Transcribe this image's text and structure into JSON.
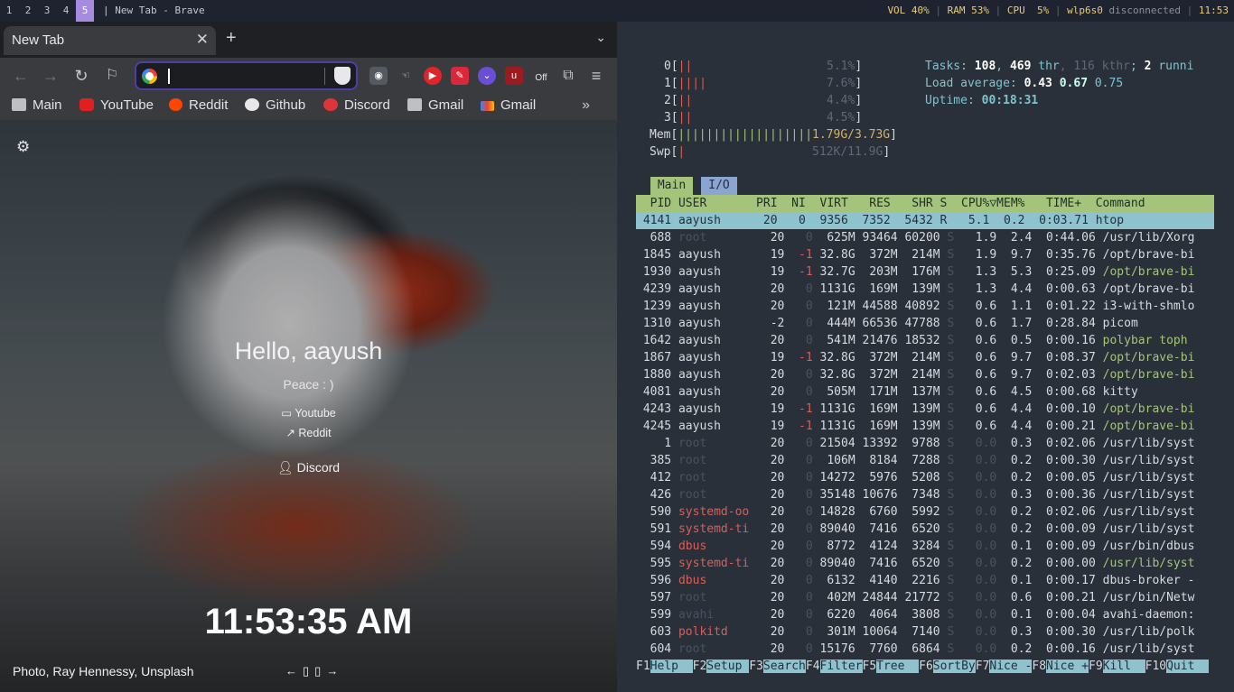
{
  "bar": {
    "workspaces": [
      "1",
      "2",
      "3",
      "4",
      "5"
    ],
    "title": "| New Tab - Brave",
    "vol": "VOL 40%",
    "ram": "RAM 53%",
    "cpu": "CPU  5%",
    "net": "wlp6s0",
    "net_state": "disconnected",
    "clock": "11:53"
  },
  "browser": {
    "tab_title": "New Tab",
    "bookmarks": [
      "Main",
      "YouTube",
      "Reddit",
      "Github",
      "Discord",
      "Gmail",
      "Gmail"
    ],
    "ext_off": "Off"
  },
  "page": {
    "greeting": "Hello, aayush",
    "subtitle": "Peace : )",
    "links": [
      "Youtube",
      "Reddit",
      "Discord"
    ],
    "clock": "11:53:35 AM",
    "credit": "Photo, Ray Hennessy, Unsplash"
  },
  "htop": {
    "cpus": [
      {
        "id": "0",
        "bar": "||",
        "pct": "5.1%"
      },
      {
        "id": "1",
        "bar": "||||",
        "pct": "7.6%"
      },
      {
        "id": "2",
        "bar": "||",
        "pct": "4.4%"
      },
      {
        "id": "3",
        "bar": "||",
        "pct": "4.5%"
      }
    ],
    "mem_bar": "|||||||||||||||||||",
    "mem": "1.79G/3.73G",
    "swp_bar": "|",
    "swp": "512K/11.9G",
    "tasks": "108",
    "thr": "469",
    "kthr": "116",
    "running": "2",
    "load1": "0.43",
    "load5": "0.67",
    "load15": "0.75",
    "uptime": "00:18:31",
    "tab_main": "Main",
    "tab_io": "I/O",
    "header": "  PID USER       PRI  NI  VIRT   RES   SHR S  CPU%▽MEM%   TIME+  Command",
    "highlight": " 4141 aayush      20   0  9356  7352  5432 R   5.1  0.2  0:03.71 htop",
    "processes": [
      [
        "688",
        "root",
        "20",
        "0",
        "625M",
        "93464",
        "60200",
        "S",
        "1.9",
        "2.4",
        "0:44.06",
        "/usr/lib/Xorg"
      ],
      [
        "1845",
        "aayush",
        "19",
        "-1",
        "32.8G",
        "372M",
        "214M",
        "S",
        "1.9",
        "9.7",
        "0:35.76",
        "/opt/brave-bi"
      ],
      [
        "1930",
        "aayush",
        "19",
        "-1",
        "32.7G",
        "203M",
        "176M",
        "S",
        "1.3",
        "5.3",
        "0:25.09",
        "/opt/brave-bi"
      ],
      [
        "4239",
        "aayush",
        "20",
        "0",
        "1131G",
        "169M",
        "139M",
        "S",
        "1.3",
        "4.4",
        "0:00.63",
        "/opt/brave-bi"
      ],
      [
        "1239",
        "aayush",
        "20",
        "0",
        "121M",
        "44588",
        "40892",
        "S",
        "0.6",
        "1.1",
        "0:01.22",
        "i3-with-shmlo"
      ],
      [
        "1310",
        "aayush",
        "-2",
        "0",
        "444M",
        "66536",
        "47788",
        "S",
        "0.6",
        "1.7",
        "0:28.84",
        "picom"
      ],
      [
        "1642",
        "aayush",
        "20",
        "0",
        "541M",
        "21476",
        "18532",
        "S",
        "0.6",
        "0.5",
        "0:00.16",
        "polybar toph"
      ],
      [
        "1867",
        "aayush",
        "19",
        "-1",
        "32.8G",
        "372M",
        "214M",
        "S",
        "0.6",
        "9.7",
        "0:08.37",
        "/opt/brave-bi"
      ],
      [
        "1880",
        "aayush",
        "20",
        "0",
        "32.8G",
        "372M",
        "214M",
        "S",
        "0.6",
        "9.7",
        "0:02.03",
        "/opt/brave-bi"
      ],
      [
        "4081",
        "aayush",
        "20",
        "0",
        "505M",
        "171M",
        "137M",
        "S",
        "0.6",
        "4.5",
        "0:00.68",
        "kitty"
      ],
      [
        "4243",
        "aayush",
        "19",
        "-1",
        "1131G",
        "169M",
        "139M",
        "S",
        "0.6",
        "4.4",
        "0:00.10",
        "/opt/brave-bi"
      ],
      [
        "4245",
        "aayush",
        "19",
        "-1",
        "1131G",
        "169M",
        "139M",
        "S",
        "0.6",
        "4.4",
        "0:00.21",
        "/opt/brave-bi"
      ],
      [
        "1",
        "root",
        "20",
        "0",
        "21504",
        "13392",
        "9788",
        "S",
        "0.0",
        "0.3",
        "0:02.06",
        "/usr/lib/syst"
      ],
      [
        "385",
        "root",
        "20",
        "0",
        "106M",
        "8184",
        "7288",
        "S",
        "0.0",
        "0.2",
        "0:00.30",
        "/usr/lib/syst"
      ],
      [
        "412",
        "root",
        "20",
        "0",
        "14272",
        "5976",
        "5208",
        "S",
        "0.0",
        "0.2",
        "0:00.05",
        "/usr/lib/syst"
      ],
      [
        "426",
        "root",
        "20",
        "0",
        "35148",
        "10676",
        "7348",
        "S",
        "0.0",
        "0.3",
        "0:00.36",
        "/usr/lib/syst"
      ],
      [
        "590",
        "systemd-oo",
        "20",
        "0",
        "14828",
        "6760",
        "5992",
        "S",
        "0.0",
        "0.2",
        "0:02.06",
        "/usr/lib/syst"
      ],
      [
        "591",
        "systemd-ti",
        "20",
        "0",
        "89040",
        "7416",
        "6520",
        "S",
        "0.0",
        "0.2",
        "0:00.09",
        "/usr/lib/syst"
      ],
      [
        "594",
        "dbus",
        "20",
        "0",
        "8772",
        "4124",
        "3284",
        "S",
        "0.0",
        "0.1",
        "0:00.09",
        "/usr/bin/dbus"
      ],
      [
        "595",
        "systemd-ti",
        "20",
        "0",
        "89040",
        "7416",
        "6520",
        "S",
        "0.0",
        "0.2",
        "0:00.00",
        "/usr/lib/syst"
      ],
      [
        "596",
        "dbus",
        "20",
        "0",
        "6132",
        "4140",
        "2216",
        "S",
        "0.0",
        "0.1",
        "0:00.17",
        "dbus-broker -"
      ],
      [
        "597",
        "root",
        "20",
        "0",
        "402M",
        "24844",
        "21772",
        "S",
        "0.0",
        "0.6",
        "0:00.21",
        "/usr/bin/Netw"
      ],
      [
        "599",
        "avahi",
        "20",
        "0",
        "6220",
        "4064",
        "3808",
        "S",
        "0.0",
        "0.1",
        "0:00.04",
        "avahi-daemon:"
      ],
      [
        "603",
        "polkitd",
        "20",
        "0",
        "301M",
        "10064",
        "7140",
        "S",
        "0.0",
        "0.3",
        "0:00.30",
        "/usr/lib/polk"
      ],
      [
        "604",
        "root",
        "20",
        "0",
        "15176",
        "7760",
        "6864",
        "S",
        "0.0",
        "0.2",
        "0:00.16",
        "/usr/lib/syst"
      ]
    ],
    "fkeys": [
      [
        "F1",
        "Help  "
      ],
      [
        "F2",
        "Setup "
      ],
      [
        "F3",
        "Search"
      ],
      [
        "F4",
        "Filter"
      ],
      [
        "F5",
        "Tree  "
      ],
      [
        "F6",
        "SortBy"
      ],
      [
        "F7",
        "Nice -"
      ],
      [
        "F8",
        "Nice +"
      ],
      [
        "F9",
        "Kill  "
      ],
      [
        "F10",
        "Quit  "
      ]
    ]
  },
  "colors": {
    "accent": "#a58ce0",
    "htop_green": "#a3c47a",
    "htop_cyan": "#8ec3cd"
  }
}
